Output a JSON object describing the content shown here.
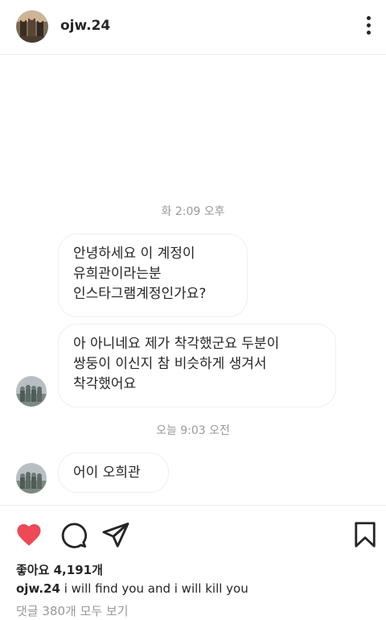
{
  "header": {
    "username": "ojw.24"
  },
  "chat": {
    "timestamp_1": "화 2:09 오후",
    "timestamp_2": "오늘 9:03 오전",
    "messages": [
      {
        "text": "안녕하세요 이 계정이\n유희관이라는분\n인스타그램계정인가요?"
      },
      {
        "text": "아 아니네요 제가 착각했군요 두분이\n쌍둥이 이신지 참 비슷하게 생겨서\n착각했어요"
      },
      {
        "text": "어이 오희관"
      }
    ]
  },
  "post": {
    "likes_text": "좋아요 4,191개",
    "caption_user": "ojw.24",
    "caption_text": "i will find you and i will kill you",
    "comments_link": "댓글 380개 모두 보기"
  },
  "colors": {
    "like_red": "#ed4956",
    "muted_text": "#999999",
    "bubble_border": "#efefef"
  },
  "icons": [
    "profile-avatar",
    "more-options-icon",
    "heart-icon",
    "comment-icon",
    "share-icon",
    "bookmark-icon"
  ]
}
